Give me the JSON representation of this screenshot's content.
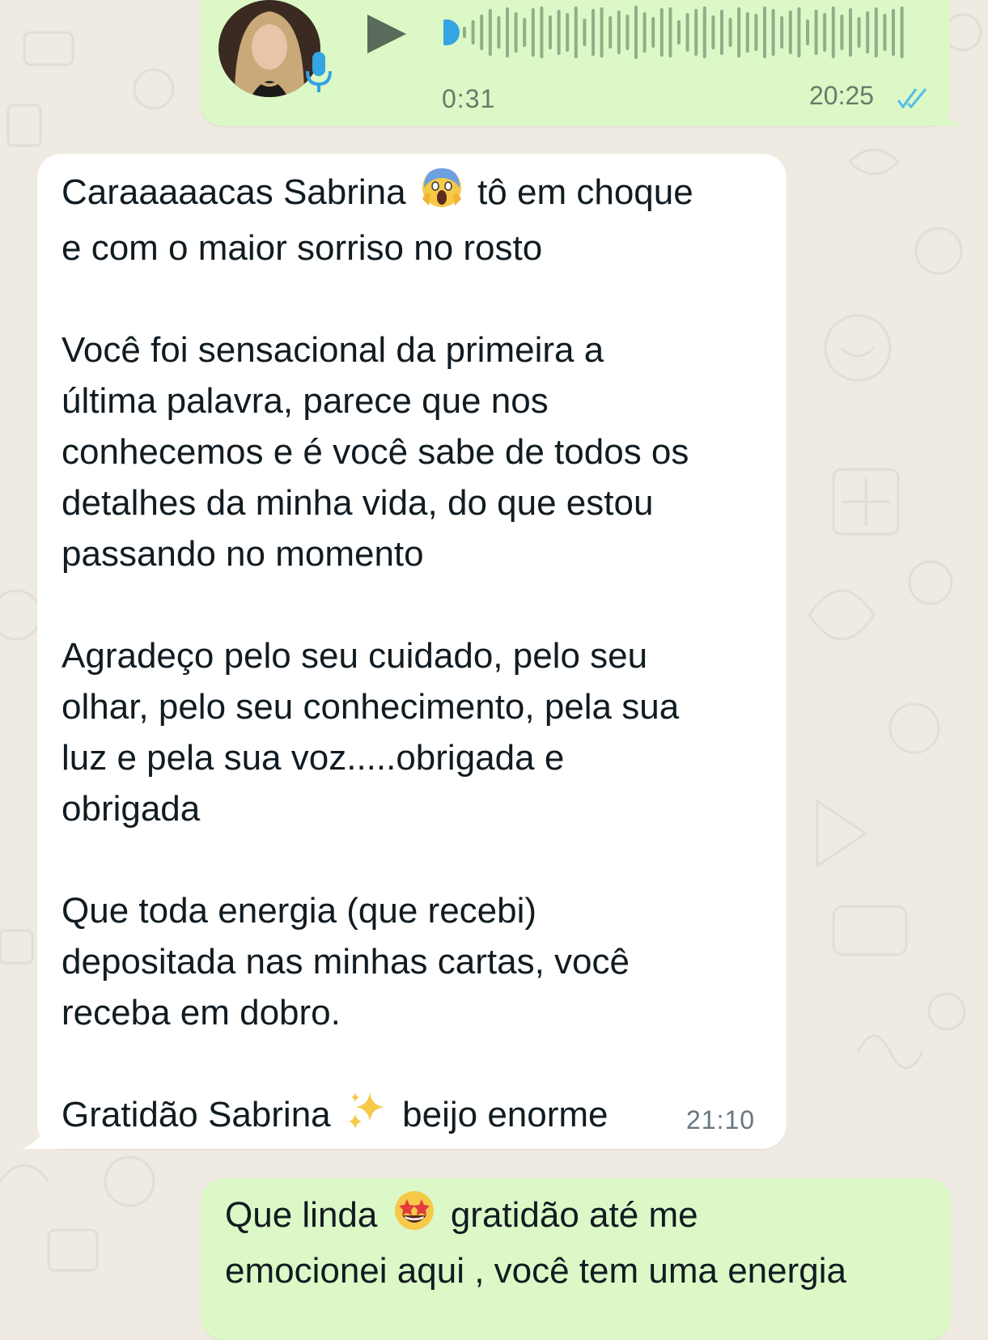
{
  "theme": {
    "wallpaper_color": "#efeae2",
    "outgoing_bubble_color": "#dcf8c6",
    "incoming_bubble_color": "#ffffff",
    "read_tick_color": "#53bdeb",
    "waveform_color": "#8fae8b",
    "progress_dot_color": "#34a4e3"
  },
  "voice_message": {
    "duration": "0:31",
    "time": "20:25",
    "status": "read",
    "icons": [
      "avatar-photo",
      "mic-icon",
      "play-icon",
      "double-check-icon"
    ]
  },
  "incoming_message": {
    "lines": [
      {
        "pre": "Caraaaaacas Sabrina",
        "emoji": "😱",
        "post": "tô em choque"
      },
      {
        "text": "e com o maior sorriso no rosto"
      },
      {
        "text": "Você foi sensacional da primeira a"
      },
      {
        "text": "última palavra, parece que nos"
      },
      {
        "text": "conhecemos e é você sabe de todos os"
      },
      {
        "text": "detalhes da minha vida, do que estou"
      },
      {
        "text": "passando no momento"
      },
      {
        "text": "Agradeço pelo seu cuidado, pelo seu"
      },
      {
        "text": "olhar, pelo seu conhecimento, pela sua"
      },
      {
        "text": "luz e pela sua voz.....obrigada e"
      },
      {
        "text": "obrigada"
      },
      {
        "text": "Que toda energia (que recebi)"
      },
      {
        "text": "depositada nas minhas cartas, você"
      },
      {
        "text": "receba em dobro."
      },
      {
        "pre": "Gratidão Sabrina",
        "emoji": "✨",
        "post": "beijo enorme"
      }
    ],
    "time": "21:10"
  },
  "outgoing_message": {
    "lines": [
      {
        "pre": "Que linda",
        "emoji": "🤩",
        "post": "gratidão até me"
      },
      {
        "text": "emocionei aqui , você tem uma energia"
      }
    ]
  }
}
